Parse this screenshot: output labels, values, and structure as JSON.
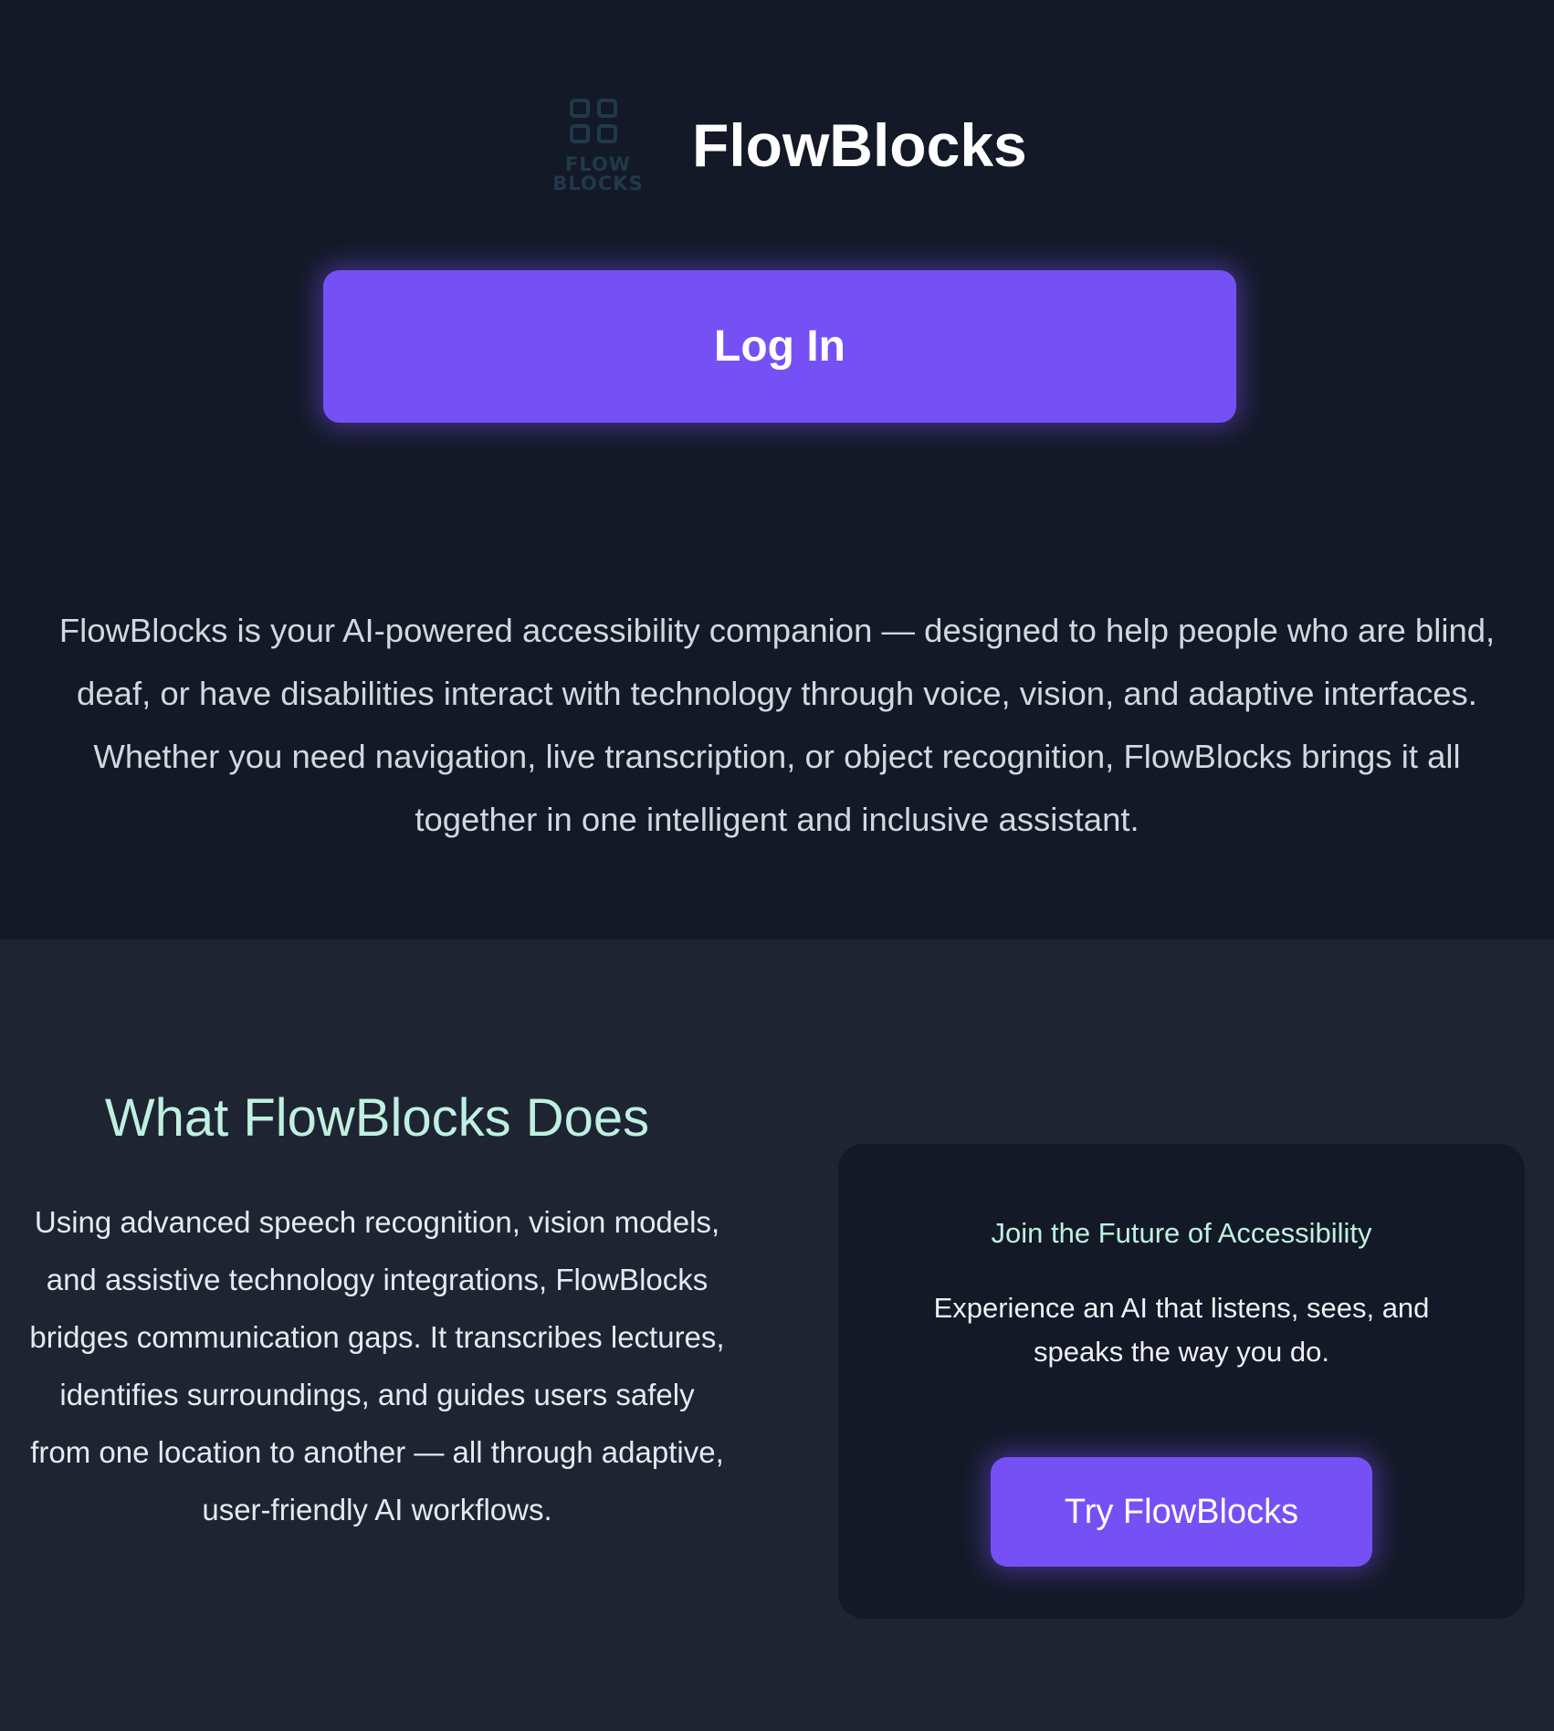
{
  "brand": {
    "name": "FlowBlocks",
    "logo_text_line1": "FLOW",
    "logo_text_line2": "BLOCKS",
    "logo_icon": "four-square-grid-icon"
  },
  "hero": {
    "login_label": "Log In",
    "intro": "FlowBlocks is your AI-powered accessibility companion — designed to help people who are blind, deaf, or have disabilities interact with technology through voice, vision, and adaptive interfaces. Whether you need navigation, live transcription, or object recognition, FlowBlocks brings it all together in one intelligent and inclusive assistant."
  },
  "features": {
    "title": "What FlowBlocks Does",
    "body": "Using advanced speech recognition, vision models, and assistive technology integrations, FlowBlocks bridges communication gaps. It transcribes lectures, identifies surroundings, and guides users safely from one location to another — all through adaptive, user-friendly AI workflows."
  },
  "cta": {
    "heading": "Join the Future of Accessibility",
    "text": "Experience an AI that listens, sees, and speaks the way you do.",
    "button_label": "Try FlowBlocks"
  },
  "colors": {
    "background_dark": "#141927",
    "background_section": "#1f2433",
    "accent_purple": "#7551f5",
    "accent_mint": "#bff0e0",
    "logo_teal": "#1f3a4a"
  }
}
